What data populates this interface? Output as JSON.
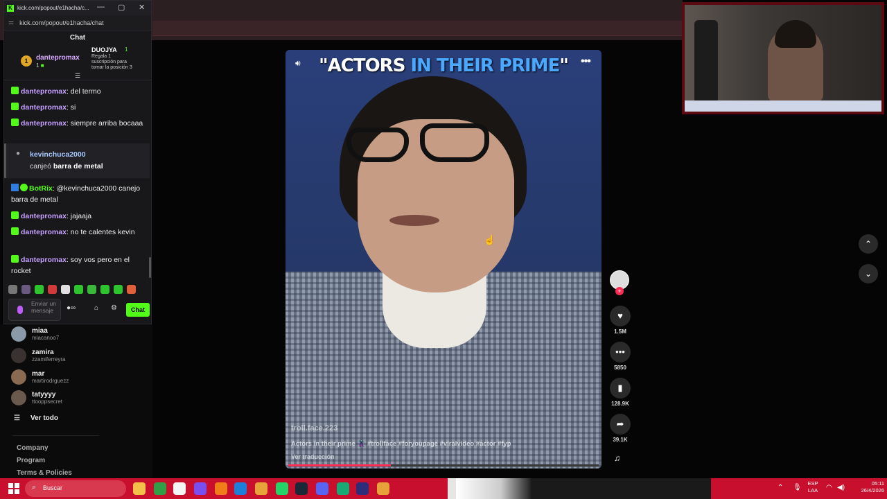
{
  "popout": {
    "title": "kick.com/popout/e1hacha/c...",
    "url": "kick.com/popout/e1hacha/chat",
    "chat_header": "Chat",
    "pinned": {
      "gifter_rank": "1",
      "gifter_name": "dantepromax",
      "gifter_count": "1",
      "user2_name": "DUOJYA",
      "user2_count": "1",
      "user2_desc": "Regala 1 suscripción para tomar la posición 3"
    },
    "messages": [
      {
        "user": "dantepromax",
        "text": ": del termo"
      },
      {
        "user": "dantepromax",
        "text": ": si"
      },
      {
        "user": "dantepromax",
        "text": ": siempre arriba bocaaa"
      }
    ],
    "redeem": {
      "user": "kevinchuca2000",
      "action": "canjeó",
      "item": "barra de metal"
    },
    "bot_msg": {
      "user": "BotRix",
      "text": ": @kevinchuca2000 canejo barra de metal"
    },
    "messages2": [
      {
        "user": "dantepromax",
        "text": ": jajaaja"
      },
      {
        "user": "dantepromax",
        "text": ": no te calentes kevin"
      },
      {
        "user": "dantepromax",
        "text": ": soy vos pero en el rocket"
      }
    ],
    "input_placeholder": "Enviar un mensaje",
    "send_label": "Chat"
  },
  "sidebar": {
    "following": [
      {
        "name": "miaa",
        "handle": "miacanoo7"
      },
      {
        "name": "zamira",
        "handle": "zzamiferreyra"
      },
      {
        "name": "mar",
        "handle": "martirodrguezz"
      },
      {
        "name": "tatyyyy",
        "handle": "ttooppsecret"
      }
    ],
    "view_all": "Ver todo",
    "footer": [
      "Company",
      "Program",
      "Terms & Policies"
    ]
  },
  "video": {
    "title_white": "\"ACTORS ",
    "title_blue": "IN THEIR PRIME",
    "title_end": "\"",
    "username": "troll.face.223",
    "description": "Actors in their prime 🦹 #trollface #foryoupage #viralvideo #actor #fyp",
    "translate": "Ver traducción",
    "progress": 0.33
  },
  "actions": {
    "likes": "1.5M",
    "comments": "5850",
    "saves": "128.9K",
    "shares": "39.1K"
  },
  "taskbar": {
    "search_placeholder": "Buscar",
    "lang_top": "ESP",
    "lang_bottom": "LAA",
    "time": "05:11",
    "date": "26/4/2026"
  }
}
